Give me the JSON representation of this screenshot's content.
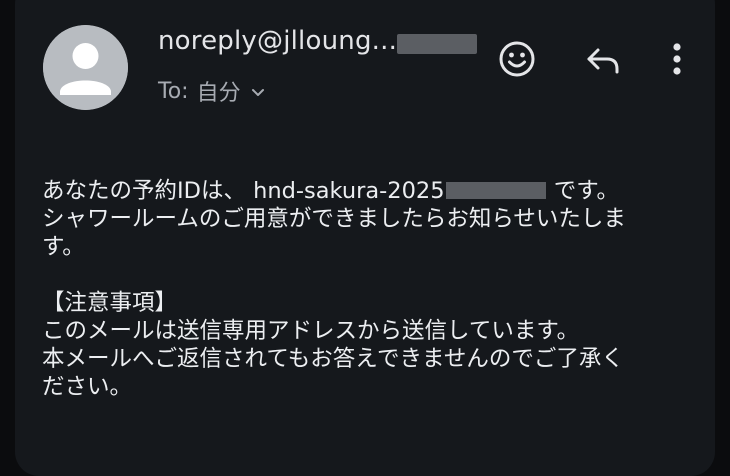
{
  "header": {
    "sender": "noreply@jlloung...",
    "to_label": "To:",
    "to_value": "自分"
  },
  "message": {
    "line1_before": "あなたの予約IDは、 hnd-sakura-2025",
    "line1_after": " です。",
    "line2": "シャワールームのご用意ができましたらお知らせいたしま",
    "line3": "す。",
    "notice_heading": "【注意事項】",
    "notice_line1": "このメールは送信専用アドレスから送信しています。",
    "notice_line2": "本メールへご返信されてもお答えできませんのでご了承く",
    "notice_line3": "ださい。"
  },
  "icons": {
    "avatar": "person-avatar-icon",
    "emoji": "emoji-reaction-icon",
    "reply": "reply-icon",
    "more": "more-vertical-icon",
    "expand": "chevron-down-icon"
  },
  "colors": {
    "background": "#15181c",
    "text": "#eceef1",
    "secondary_text": "#a7abb2",
    "avatar": "#b8bcc1",
    "redaction": "#5b5e63"
  }
}
